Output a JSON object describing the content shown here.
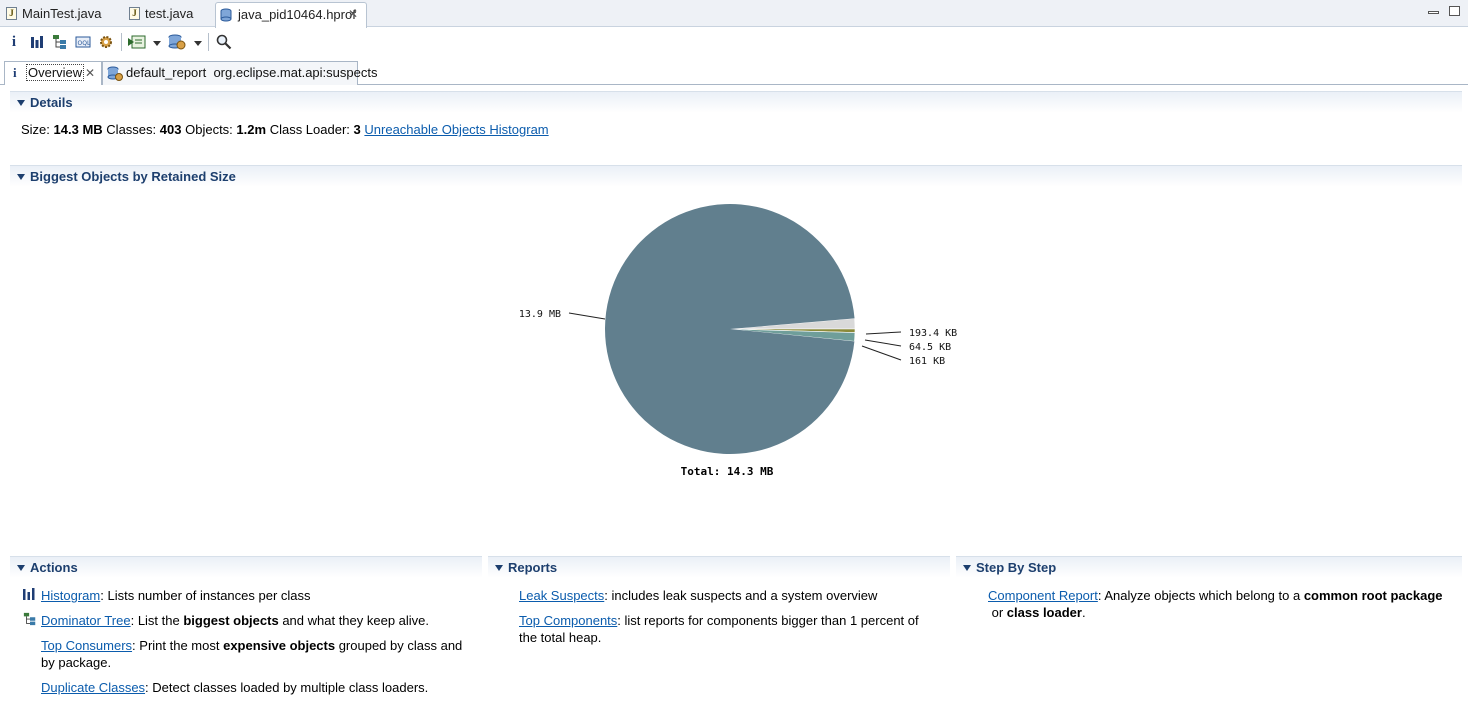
{
  "editor_tabs": [
    {
      "label": "MainTest.java",
      "icon": "java-file-icon"
    },
    {
      "label": "test.java",
      "icon": "java-file-icon"
    },
    {
      "label": "java_pid10464.hprof",
      "icon": "heap-dump-icon",
      "active": true
    }
  ],
  "toolbar": {
    "buttons": [
      "info-icon",
      "histogram-icon",
      "dominator-tree-icon",
      "oql-icon",
      "gear-icon",
      "run-report-icon",
      "query-browser-icon",
      "search-icon"
    ]
  },
  "inner_tabs": [
    {
      "label": "Overview",
      "active": true
    },
    {
      "label": "default_report  org.eclipse.mat.api:suspects"
    }
  ],
  "details": {
    "header": "Details",
    "size_label": "Size:",
    "size_value": "14.3 MB",
    "classes_label": "Classes:",
    "classes_value": "403",
    "objects_label": "Objects:",
    "objects_value": "1.2m",
    "loader_label": "Class Loader:",
    "loader_value": "3",
    "unreachable_link": "Unreachable Objects Histogram"
  },
  "biggest": {
    "header": "Biggest Objects by Retained Size"
  },
  "chart_data": {
    "type": "pie",
    "slices": [
      {
        "label": "13.9 MB",
        "value": 13.9,
        "color": "#617f8e"
      },
      {
        "label": "193.4 KB",
        "value": 0.1934,
        "color": "#d9d9d9"
      },
      {
        "label": "64.5 KB",
        "value": 0.0645,
        "color": "#8a8a3a"
      },
      {
        "label": "161 KB",
        "value": 0.161,
        "color": "#6f9e9a"
      }
    ],
    "total_label": "Total: 14.3 MB"
  },
  "actions": {
    "header": "Actions",
    "histogram_link": "Histogram",
    "histogram_text": ": Lists number of instances per class",
    "dominator_link": "Dominator Tree",
    "dominator_text1": ": List the ",
    "dominator_bold": "biggest objects",
    "dominator_text2": " and what they keep alive.",
    "consumers_link": "Top Consumers",
    "consumers_text1": ": Print the most ",
    "consumers_bold": "expensive objects",
    "consumers_text2": " grouped by class and",
    "consumers_text3": "by package.",
    "duplicate_link": "Duplicate Classes",
    "duplicate_text": ": Detect classes loaded by multiple class loaders."
  },
  "reports": {
    "header": "Reports",
    "leak_link": "Leak Suspects",
    "leak_text": ": includes leak suspects and a system overview",
    "components_link": "Top Components",
    "components_text1": ": list reports for components bigger than 1 percent of",
    "components_text2": "the total heap."
  },
  "step": {
    "header": "Step By Step",
    "component_link": "Component Report",
    "component_text1": ": Analyze objects which belong to a ",
    "component_bold1": "common root package",
    "component_text2": " or ",
    "component_bold2": "class loader",
    "component_text3": "."
  }
}
